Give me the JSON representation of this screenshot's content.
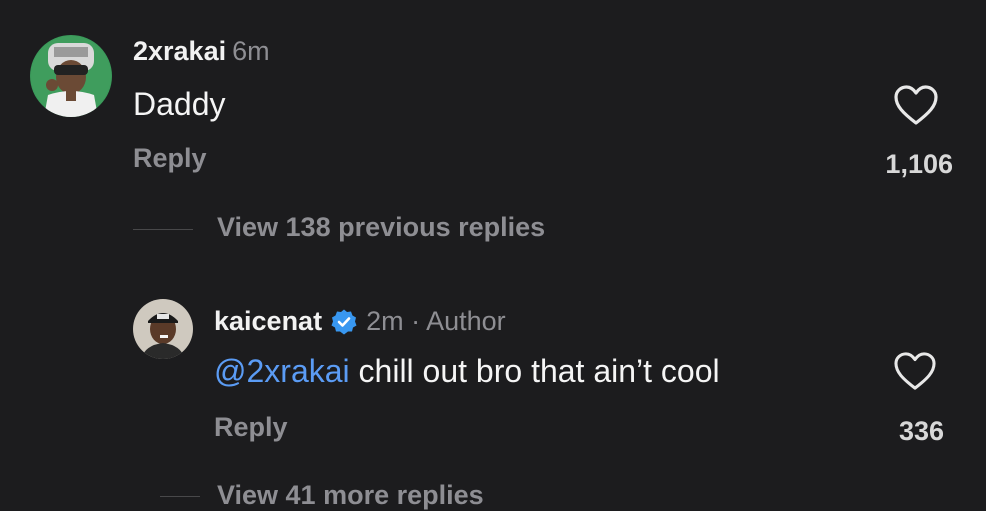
{
  "colors": {
    "background": "#1c1c1e",
    "primary_text": "#f5f5f5",
    "secondary_text": "#8e8e93",
    "mention": "#5b9cf5",
    "verified_badge": "#3897f0"
  },
  "comments": [
    {
      "username": "2xrakai",
      "time": "6m",
      "text": "Daddy",
      "reply_label": "Reply",
      "likes": "1,106",
      "avatar_icon": "profile-photo",
      "like_icon": "heart-outline-icon"
    }
  ],
  "view_previous": {
    "label": "View 138 previous replies"
  },
  "reply": {
    "username": "kaicenat",
    "verified_icon": "verified-badge-icon",
    "meta": "2m · Author",
    "mention": "@2xrakai",
    "text": " chill out bro that ain’t cool",
    "reply_label": "Reply",
    "likes": "336",
    "avatar_icon": "profile-photo",
    "like_icon": "heart-outline-icon"
  },
  "view_more": {
    "label": "View 41 more replies"
  }
}
